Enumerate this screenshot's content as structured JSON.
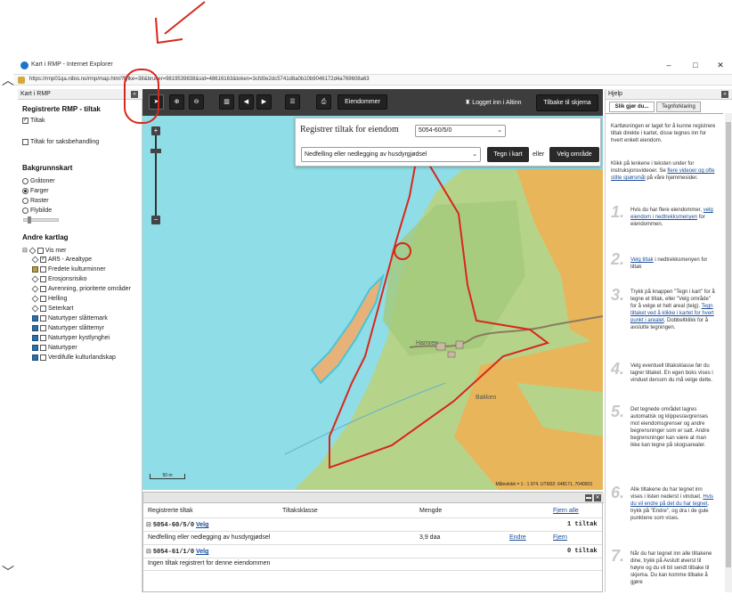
{
  "browser": {
    "title": "Kart i RMP - Internet Explorer",
    "url": "https://rmp01qa.nibio.no/rmp/map.html?fylke=38&bruker=9819539838&sid=48616163&token=3cfd0e2dc5741d8a0b10b9046172d4a769608a63",
    "minimize": "–",
    "maximize": "□",
    "close": "✕"
  },
  "left_panel": {
    "header": "Kart i RMP",
    "collapse": "«",
    "registrerte": {
      "title": "Registrerte RMP - tiltak",
      "tiltak": "Tiltak",
      "saksbehandling": "Tiltak for saksbehandling"
    },
    "bakgrunn": {
      "title": "Bakgrunnskart",
      "options": [
        "Gråtoner",
        "Farger",
        "Raster",
        "Flybilde"
      ],
      "selected": "Farger"
    },
    "andre": {
      "title": "Andre kartlag",
      "layers": [
        "Vis mer",
        "AR5 - Arealtype",
        "Fredete kulturminner",
        "Erosjonsrisiko",
        "Avrenning, prioriterte områder",
        "Helling",
        "Seterkart",
        "Naturtyper slåttemark",
        "Naturtyper slåttemyr",
        "Naturtyper kystlynghei",
        "Naturtyper",
        "Verdifulle kulturlandskap"
      ]
    }
  },
  "toolbar": {
    "eiendommer": "Eiendommer",
    "logged_in": "Logget inn i Altinn",
    "back": "Tilbake til skjema"
  },
  "register": {
    "title": "Registrer tiltak for eiendom",
    "property": "5054-60/5/0",
    "measure": "Nedfelling eller nedlegging av husdyrgjødsel",
    "draw_btn": "Tegn i kart",
    "or": "eller",
    "area_btn": "Velg område"
  },
  "map": {
    "places": [
      "Hamren",
      "Bakken"
    ],
    "scale": "50 m",
    "coords": "Målestokk = 1 : 1 974. UTM32: 648171, 7040003"
  },
  "table": {
    "headers": [
      "Registrerte tiltak",
      "Tiltaksklasse",
      "Mengde"
    ],
    "remove_all": "Fjern alle",
    "groups": [
      {
        "property": "5054-60/5/0",
        "select": "Velg",
        "count": "1 tiltak",
        "rows": [
          {
            "name": "Nedfelling eller nedlegging av husdyrgjødsel",
            "amount": "3,9 daa",
            "edit": "Endre",
            "remove": "Fjern"
          }
        ]
      },
      {
        "property": "5054-61/1/0",
        "select": "Velg",
        "count": "0 tiltak",
        "empty": "Ingen tiltak registrert for denne eiendommen"
      }
    ]
  },
  "help": {
    "header": "Hjelp",
    "collapse": "»",
    "tab_active": "Slik gjør du...",
    "tab_other": "Tegnforklaring",
    "intro1": "Kartløsningen er laget for å kunne registrere tiltak direkte i kartet, disse tegnes inn for hvert enkelt eiendom.",
    "intro2_a": "Klikk på lenkene i teksten under for instruksjonsvideoer. Se ",
    "intro2_link": "flere videoer og ofte stilte spørsmål",
    "intro2_b": " på våre hjemmesider.",
    "steps": [
      {
        "num": "1.",
        "a": "Hvis du har flere eiendommer, ",
        "link": "velg eiendom i nedtrekksmenyen",
        "b": " for eiendommen."
      },
      {
        "num": "2.",
        "a": "",
        "link": "Velg tiltak",
        "b": " i nedtrekksmenyen for tiltak"
      },
      {
        "num": "3.",
        "a": "Trykk på knappen \"Tegn i kart\" for å tegne et tiltak, eller \"Velg område\" for å velge et helt areal (teig). ",
        "link": "Tegn tiltaket ved å klikke i kartet for hvert punkt i arealet",
        "b": ". Dobbeltklikk for å avslutte tegningen."
      },
      {
        "num": "4.",
        "a": "Velg eventuell tiltaksklasse før du lagrer tiltaket. En egen boks vises i vinduet dersom du må velge dette.",
        "link": "",
        "b": ""
      },
      {
        "num": "5.",
        "a": "Det tegnede området lagres automatisk og klippes/avgrenses mot eiendomsgrenser og andre begrensninger som er satt. Andre begrensninger kan være at man ikke kan tegne på skogsarealer.",
        "link": "",
        "b": ""
      },
      {
        "num": "6.",
        "a": "Alle tiltakene du har tegnet inn vises i listen nederst i vinduet. ",
        "link": "Hvis du vil endre på det du har tegnet",
        "b": ", trykk på \"Endre\", og dra i de gule punktene som vises."
      },
      {
        "num": "7.",
        "a": "Når du har tegnet inn alle tiltakene dine, trykk på Avslutt øverst til høyre og du vil bli sendt tilbake til skjema. Du kan komme tilbake å gjøre",
        "link": "",
        "b": ""
      }
    ]
  }
}
